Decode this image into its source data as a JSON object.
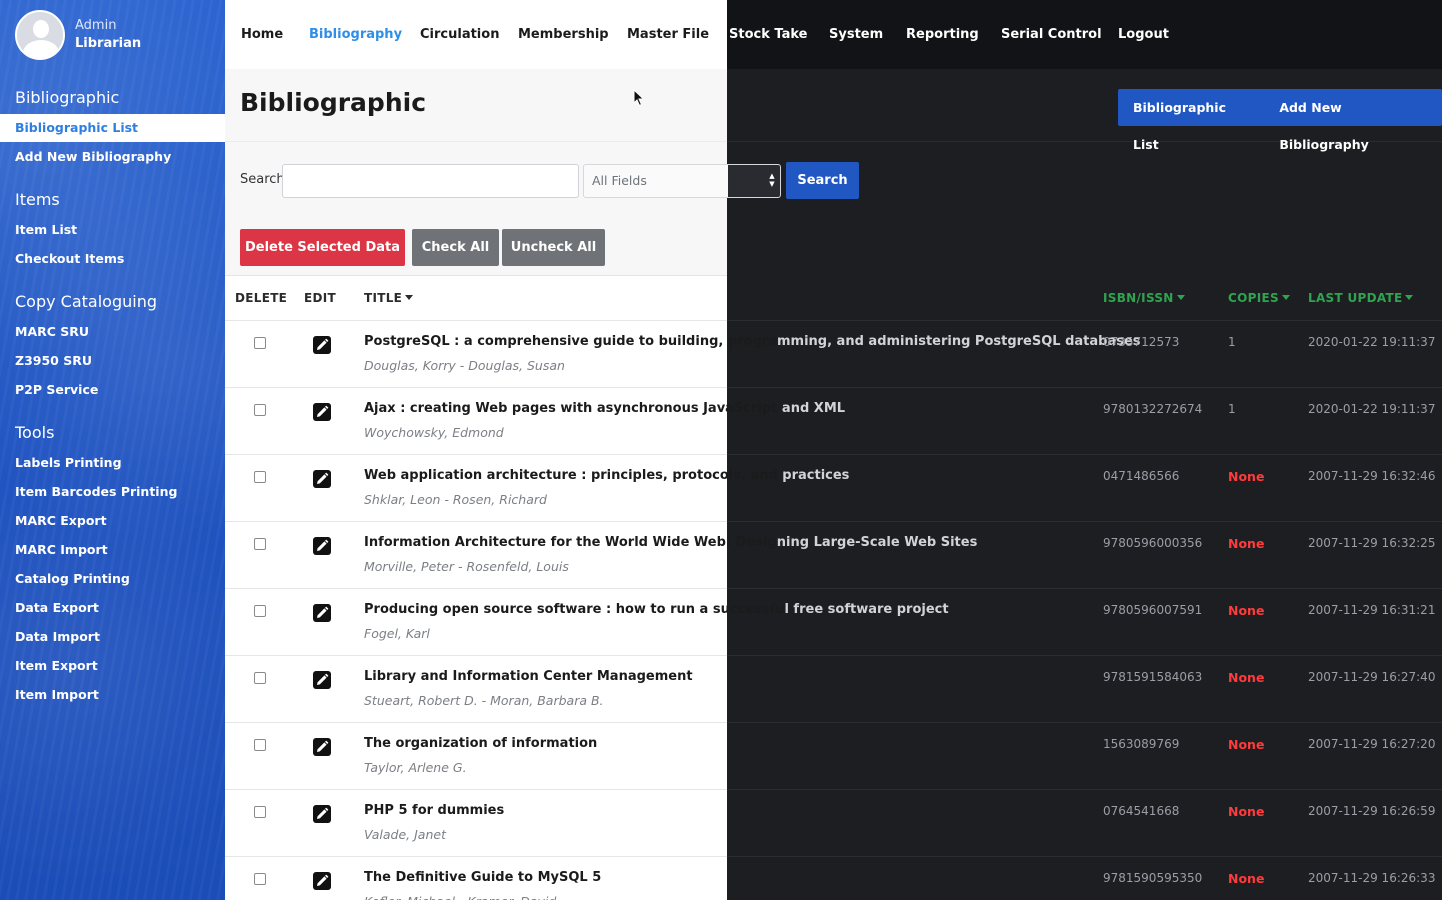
{
  "user": {
    "role": "Admin",
    "name": "Librarian"
  },
  "sidebar": {
    "sections": [
      {
        "title": "Bibliographic",
        "items": [
          "Bibliographic List",
          "Add New Bibliography"
        ]
      },
      {
        "title": "Items",
        "items": [
          "Item List",
          "Checkout Items"
        ]
      },
      {
        "title": "Copy Cataloguing",
        "items": [
          "MARC SRU",
          "Z3950 SRU",
          "P2P Service"
        ]
      },
      {
        "title": "Tools",
        "items": [
          "Labels Printing",
          "Item Barcodes Printing",
          "MARC Export",
          "MARC Import",
          "Catalog Printing",
          "Data Export",
          "Data Import",
          "Item Export",
          "Item Import"
        ]
      }
    ],
    "active_item": "Bibliographic List"
  },
  "nav": [
    "Home",
    "Bibliography",
    "Circulation",
    "Membership",
    "Master File",
    "Stock Take",
    "System",
    "Reporting",
    "Serial Control",
    "Logout"
  ],
  "nav_active": "Bibliography",
  "page": {
    "title": "Bibliographic",
    "header_buttons": [
      "Bibliographic List",
      "Add New Bibliography"
    ]
  },
  "search": {
    "label": "Search",
    "value": "",
    "field_selected": "All Fields",
    "button": "Search"
  },
  "actions": {
    "delete": "Delete Selected Data",
    "check_all": "Check All",
    "uncheck_all": "Uncheck All"
  },
  "table": {
    "headers": {
      "delete": "DELETE",
      "edit": "EDIT",
      "title": "TITLE",
      "isbn": "ISBN/ISSN",
      "copies": "COPIES",
      "last_update": "LAST UPDATE"
    },
    "rows": [
      {
        "title_a": "PostgreSQL : a comprehensive guide to building, progra",
        "title_b": "mming, and administering PostgreSQL databases",
        "author": "Douglas, Korry - Douglas, Susan",
        "isbn": "0735712573",
        "copies": "1",
        "updated": "2020-01-22 19:11:37"
      },
      {
        "title_a": "Ajax : creating Web pages with asynchronous JavaScript",
        "title_b": " and XML",
        "author": "Woychowsky, Edmond",
        "isbn": "9780132272674",
        "copies": "1",
        "updated": "2020-01-22 19:11:37"
      },
      {
        "title_a": "Web application architecture : principles, protocols, and ",
        "title_b": "practices",
        "author": "Shklar, Leon - Rosen, Richard",
        "isbn": "0471486566",
        "copies": "None",
        "updated": "2007-11-29 16:32:46"
      },
      {
        "title_a": "Information Architecture for the World Wide Web: Desig",
        "title_b": "ning Large-Scale Web Sites",
        "author": "Morville, Peter - Rosenfeld, Louis",
        "isbn": "9780596000356",
        "copies": "None",
        "updated": "2007-11-29 16:32:25"
      },
      {
        "title_a": "Producing open source software : how to run a successfu",
        "title_b": "l free software project",
        "author": "Fogel, Karl",
        "isbn": "9780596007591",
        "copies": "None",
        "updated": "2007-11-29 16:31:21"
      },
      {
        "title_a": "Library and Information Center Management",
        "title_b": "",
        "author": "Stueart, Robert D. - Moran, Barbara B.",
        "isbn": "9781591584063",
        "copies": "None",
        "updated": "2007-11-29 16:27:40"
      },
      {
        "title_a": "The organization of information",
        "title_b": "",
        "author": "Taylor, Arlene G.",
        "isbn": "1563089769",
        "copies": "None",
        "updated": "2007-11-29 16:27:20"
      },
      {
        "title_a": "PHP 5 for dummies",
        "title_b": "",
        "author": "Valade, Janet",
        "isbn": "0764541668",
        "copies": "None",
        "updated": "2007-11-29 16:26:59"
      },
      {
        "title_a": "The Definitive Guide to MySQL 5",
        "title_b": "",
        "author": "Kofler, Michael - Kramer, David",
        "isbn": "9781590595350",
        "copies": "None",
        "updated": "2007-11-29 16:26:33"
      }
    ]
  },
  "colors": {
    "sidebar": "#2257c4",
    "primary": "#2157c3",
    "danger": "#dc3545",
    "accent_link": "#2f8fe8",
    "header_green": "#2fa44f",
    "none_red": "#ff3b3b"
  }
}
